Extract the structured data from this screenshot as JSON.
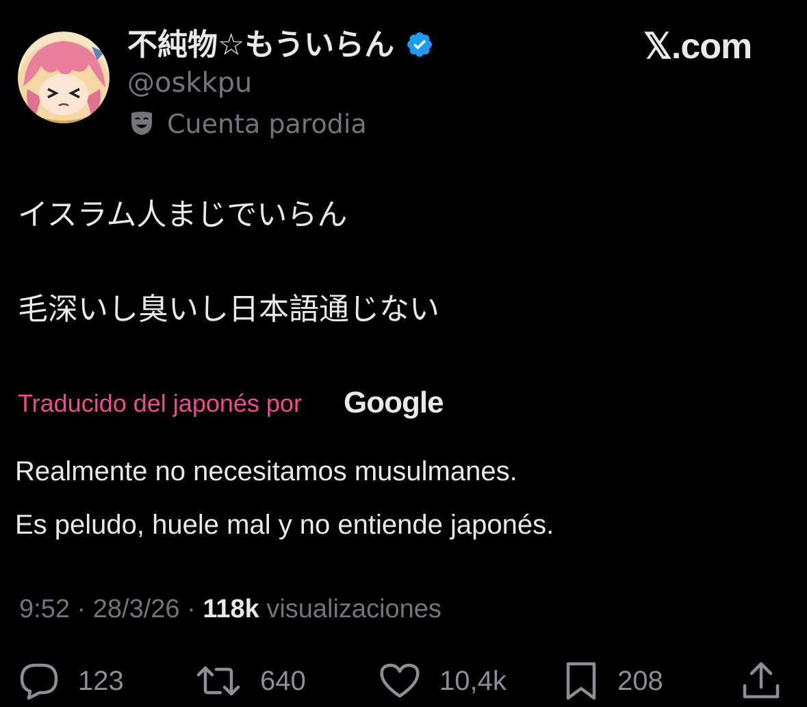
{
  "tweet": {
    "author": {
      "display_name": "不純物☆もういらん",
      "handle": "@oskkpu",
      "label": "Cuenta parodia",
      "verified": true,
      "avatar_icon": "anime-avatar"
    },
    "site_watermark": "𝕏.com",
    "original_text": {
      "line1": "イスラム人まじでいらん",
      "line2": "毛深いし臭いし日本語通じない"
    },
    "translation": {
      "attribution": "Traducido del japonés por",
      "provider": "Google",
      "line1": "Realmente no necesitamos musulmanes.",
      "line2": "Es peludo, huele mal y no entiende japonés."
    },
    "meta": {
      "time": "9:52",
      "separator": " · ",
      "date": "28/3/26",
      "views_count": "118k",
      "views_label": " visualizaciones"
    },
    "actions": {
      "replies": "123",
      "reposts": "640",
      "likes": "10,4k",
      "bookmarks": "208"
    }
  },
  "colors": {
    "background": "#000000",
    "text_primary": "#e7e9ea",
    "text_secondary": "#71767b",
    "verified_blue": "#1d9bf0",
    "translation_pink": "#f24a92"
  },
  "icons": {
    "verified": "verified-badge-icon",
    "parody": "theater-mask-icon",
    "reply": "speech-bubble-icon",
    "repost": "repost-arrows-icon",
    "like": "heart-icon",
    "bookmark": "bookmark-icon",
    "share": "share-upload-icon"
  }
}
